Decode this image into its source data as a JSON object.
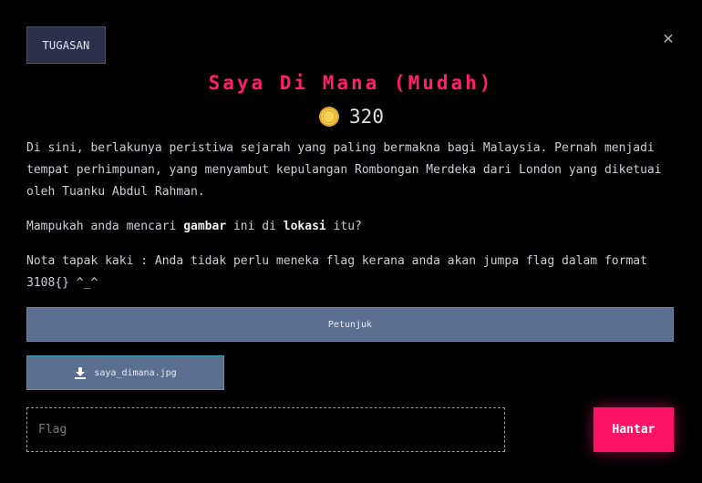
{
  "header": {
    "category_label": "TUGASAN",
    "close_icon": "close-icon"
  },
  "challenge": {
    "title": "Saya Di Mana (Mudah)",
    "points": "320",
    "coin_icon": "coin-icon",
    "coin_color": "#f2c94c",
    "description": "Di sini, berlakunya peristiwa sejarah yang paling bermakna bagi Malaysia. Pernah menjadi tempat perhimpunan, yang menyambut kepulangan Rombongan Merdeka dari London yang diketuai oleh Tuanku Abdul Rahman.",
    "question": {
      "part1": "Mampukah anda mencari ",
      "bold1": "gambar",
      "part2": " ini di ",
      "bold2": "lokasi",
      "part3": " itu?"
    },
    "footnote": "Nota tapak kaki : Anda tidak perlu meneka flag kerana anda akan jumpa flag dalam format 3108{} ^_^"
  },
  "actions": {
    "hint_label": "Petunjuk",
    "download_label": "saya_dimana.jpg",
    "download_icon": "download-icon",
    "flag_placeholder": "Flag",
    "flag_value": "",
    "submit_label": "Hantar",
    "accent_color": "#ff1366"
  }
}
